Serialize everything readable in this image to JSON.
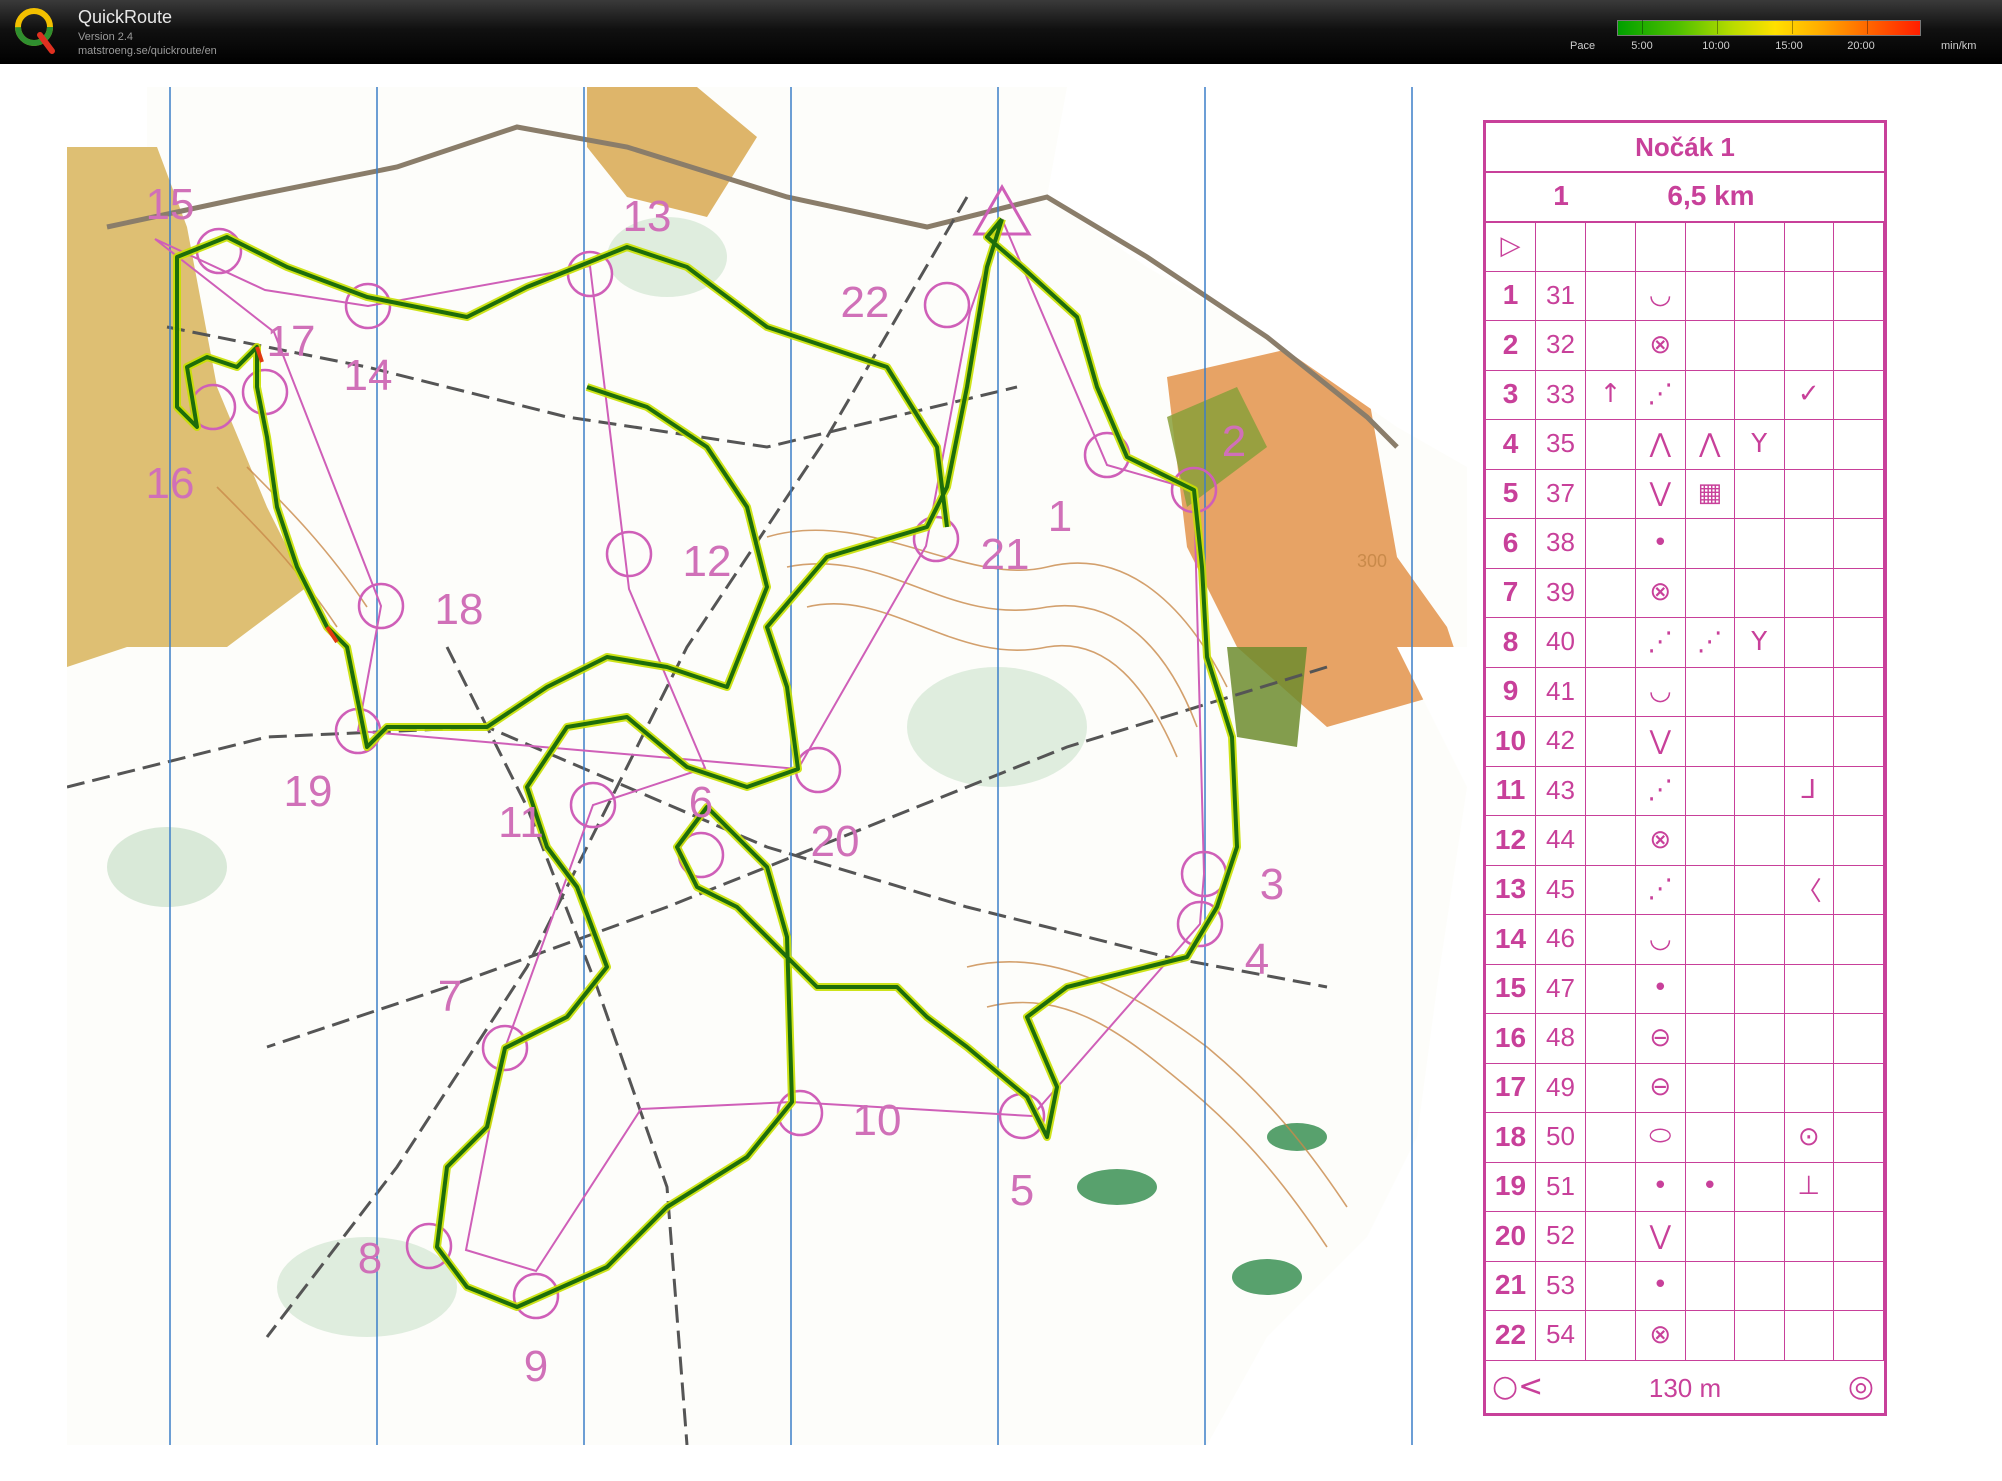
{
  "app": {
    "title": "QuickRoute",
    "version": "Version 2.4",
    "url": "matstroeng.se/quickroute/en"
  },
  "pace": {
    "label": "Pace",
    "ticks": [
      "5:00",
      "10:00",
      "15:00",
      "20:00"
    ],
    "unit": "min/km",
    "colors": [
      "#00a000",
      "#b9dc00",
      "#ffe000",
      "#ff6a00",
      "#ff1e00"
    ]
  },
  "map": {
    "control_numbers": [
      {
        "n": "1"
      },
      {
        "n": "2"
      },
      {
        "n": "3"
      },
      {
        "n": "4"
      },
      {
        "n": "5"
      },
      {
        "n": "6"
      },
      {
        "n": "7"
      },
      {
        "n": "8"
      },
      {
        "n": "9"
      },
      {
        "n": "10"
      },
      {
        "n": "11"
      },
      {
        "n": "12"
      },
      {
        "n": "13"
      },
      {
        "n": "14"
      },
      {
        "n": "15"
      },
      {
        "n": "16"
      },
      {
        "n": "17"
      },
      {
        "n": "18"
      },
      {
        "n": "19"
      },
      {
        "n": "20"
      },
      {
        "n": "21"
      },
      {
        "n": "22"
      }
    ],
    "contour_label": "300",
    "colors": {
      "control": "#cf5fb8",
      "route": "#1d6d0a",
      "route_glow": "#c8e000",
      "north_lines": "#3c7ec8"
    }
  },
  "description": {
    "event": "Nočák 1",
    "course": "1",
    "length": "6,5 km",
    "start_symbol": "▷",
    "controls": [
      {
        "num": "1",
        "code": "31",
        "c": "",
        "d": "◡",
        "e": "",
        "f": "",
        "g": "",
        "h": ""
      },
      {
        "num": "2",
        "code": "32",
        "c": "",
        "d": "⊗",
        "e": "",
        "f": "",
        "g": "",
        "h": ""
      },
      {
        "num": "3",
        "code": "33",
        "c": "↑",
        "d": "⋰",
        "e": "",
        "f": "",
        "g": "✓",
        "h": ""
      },
      {
        "num": "4",
        "code": "35",
        "c": "",
        "d": "⋀",
        "e": "⋀",
        "f": "Y",
        "g": "",
        "h": ""
      },
      {
        "num": "5",
        "code": "37",
        "c": "",
        "d": "⋁",
        "e": "▦",
        "f": "",
        "g": "",
        "h": ""
      },
      {
        "num": "6",
        "code": "38",
        "c": "",
        "d": "•",
        "e": "",
        "f": "",
        "g": "",
        "h": ""
      },
      {
        "num": "7",
        "code": "39",
        "c": "",
        "d": "⊗",
        "e": "",
        "f": "",
        "g": "",
        "h": ""
      },
      {
        "num": "8",
        "code": "40",
        "c": "",
        "d": "⋰",
        "e": "⋰",
        "f": "Y",
        "g": "",
        "h": ""
      },
      {
        "num": "9",
        "code": "41",
        "c": "",
        "d": "◡",
        "e": "",
        "f": "",
        "g": "",
        "h": ""
      },
      {
        "num": "10",
        "code": "42",
        "c": "",
        "d": "⋁",
        "e": "",
        "f": "",
        "g": "",
        "h": ""
      },
      {
        "num": "11",
        "code": "43",
        "c": "",
        "d": "⋰",
        "e": "",
        "f": "",
        "g": "⅃",
        "h": ""
      },
      {
        "num": "12",
        "code": "44",
        "c": "",
        "d": "⊗",
        "e": "",
        "f": "",
        "g": "",
        "h": ""
      },
      {
        "num": "13",
        "code": "45",
        "c": "",
        "d": "⋰",
        "e": "",
        "f": "",
        "g": "〈",
        "h": ""
      },
      {
        "num": "14",
        "code": "46",
        "c": "",
        "d": "◡",
        "e": "",
        "f": "",
        "g": "",
        "h": ""
      },
      {
        "num": "15",
        "code": "47",
        "c": "",
        "d": "•",
        "e": "",
        "f": "",
        "g": "",
        "h": ""
      },
      {
        "num": "16",
        "code": "48",
        "c": "",
        "d": "⊖",
        "e": "",
        "f": "",
        "g": "",
        "h": ""
      },
      {
        "num": "17",
        "code": "49",
        "c": "",
        "d": "⊖",
        "e": "",
        "f": "",
        "g": "",
        "h": ""
      },
      {
        "num": "18",
        "code": "50",
        "c": "",
        "d": "⬭",
        "e": "",
        "f": "",
        "g": "⊙",
        "h": ""
      },
      {
        "num": "19",
        "code": "51",
        "c": "",
        "d": "•",
        "e": "•",
        "f": "",
        "g": "⊥",
        "h": ""
      },
      {
        "num": "20",
        "code": "52",
        "c": "",
        "d": "⋁",
        "e": "",
        "f": "",
        "g": "",
        "h": ""
      },
      {
        "num": "21",
        "code": "53",
        "c": "",
        "d": "•",
        "e": "",
        "f": "",
        "g": "",
        "h": ""
      },
      {
        "num": "22",
        "code": "54",
        "c": "",
        "d": "⊗",
        "e": "",
        "f": "",
        "g": "",
        "h": ""
      }
    ],
    "finish_distance": "130 m",
    "finish_left_symbol": "○<",
    "finish_right_symbol": "◎"
  }
}
